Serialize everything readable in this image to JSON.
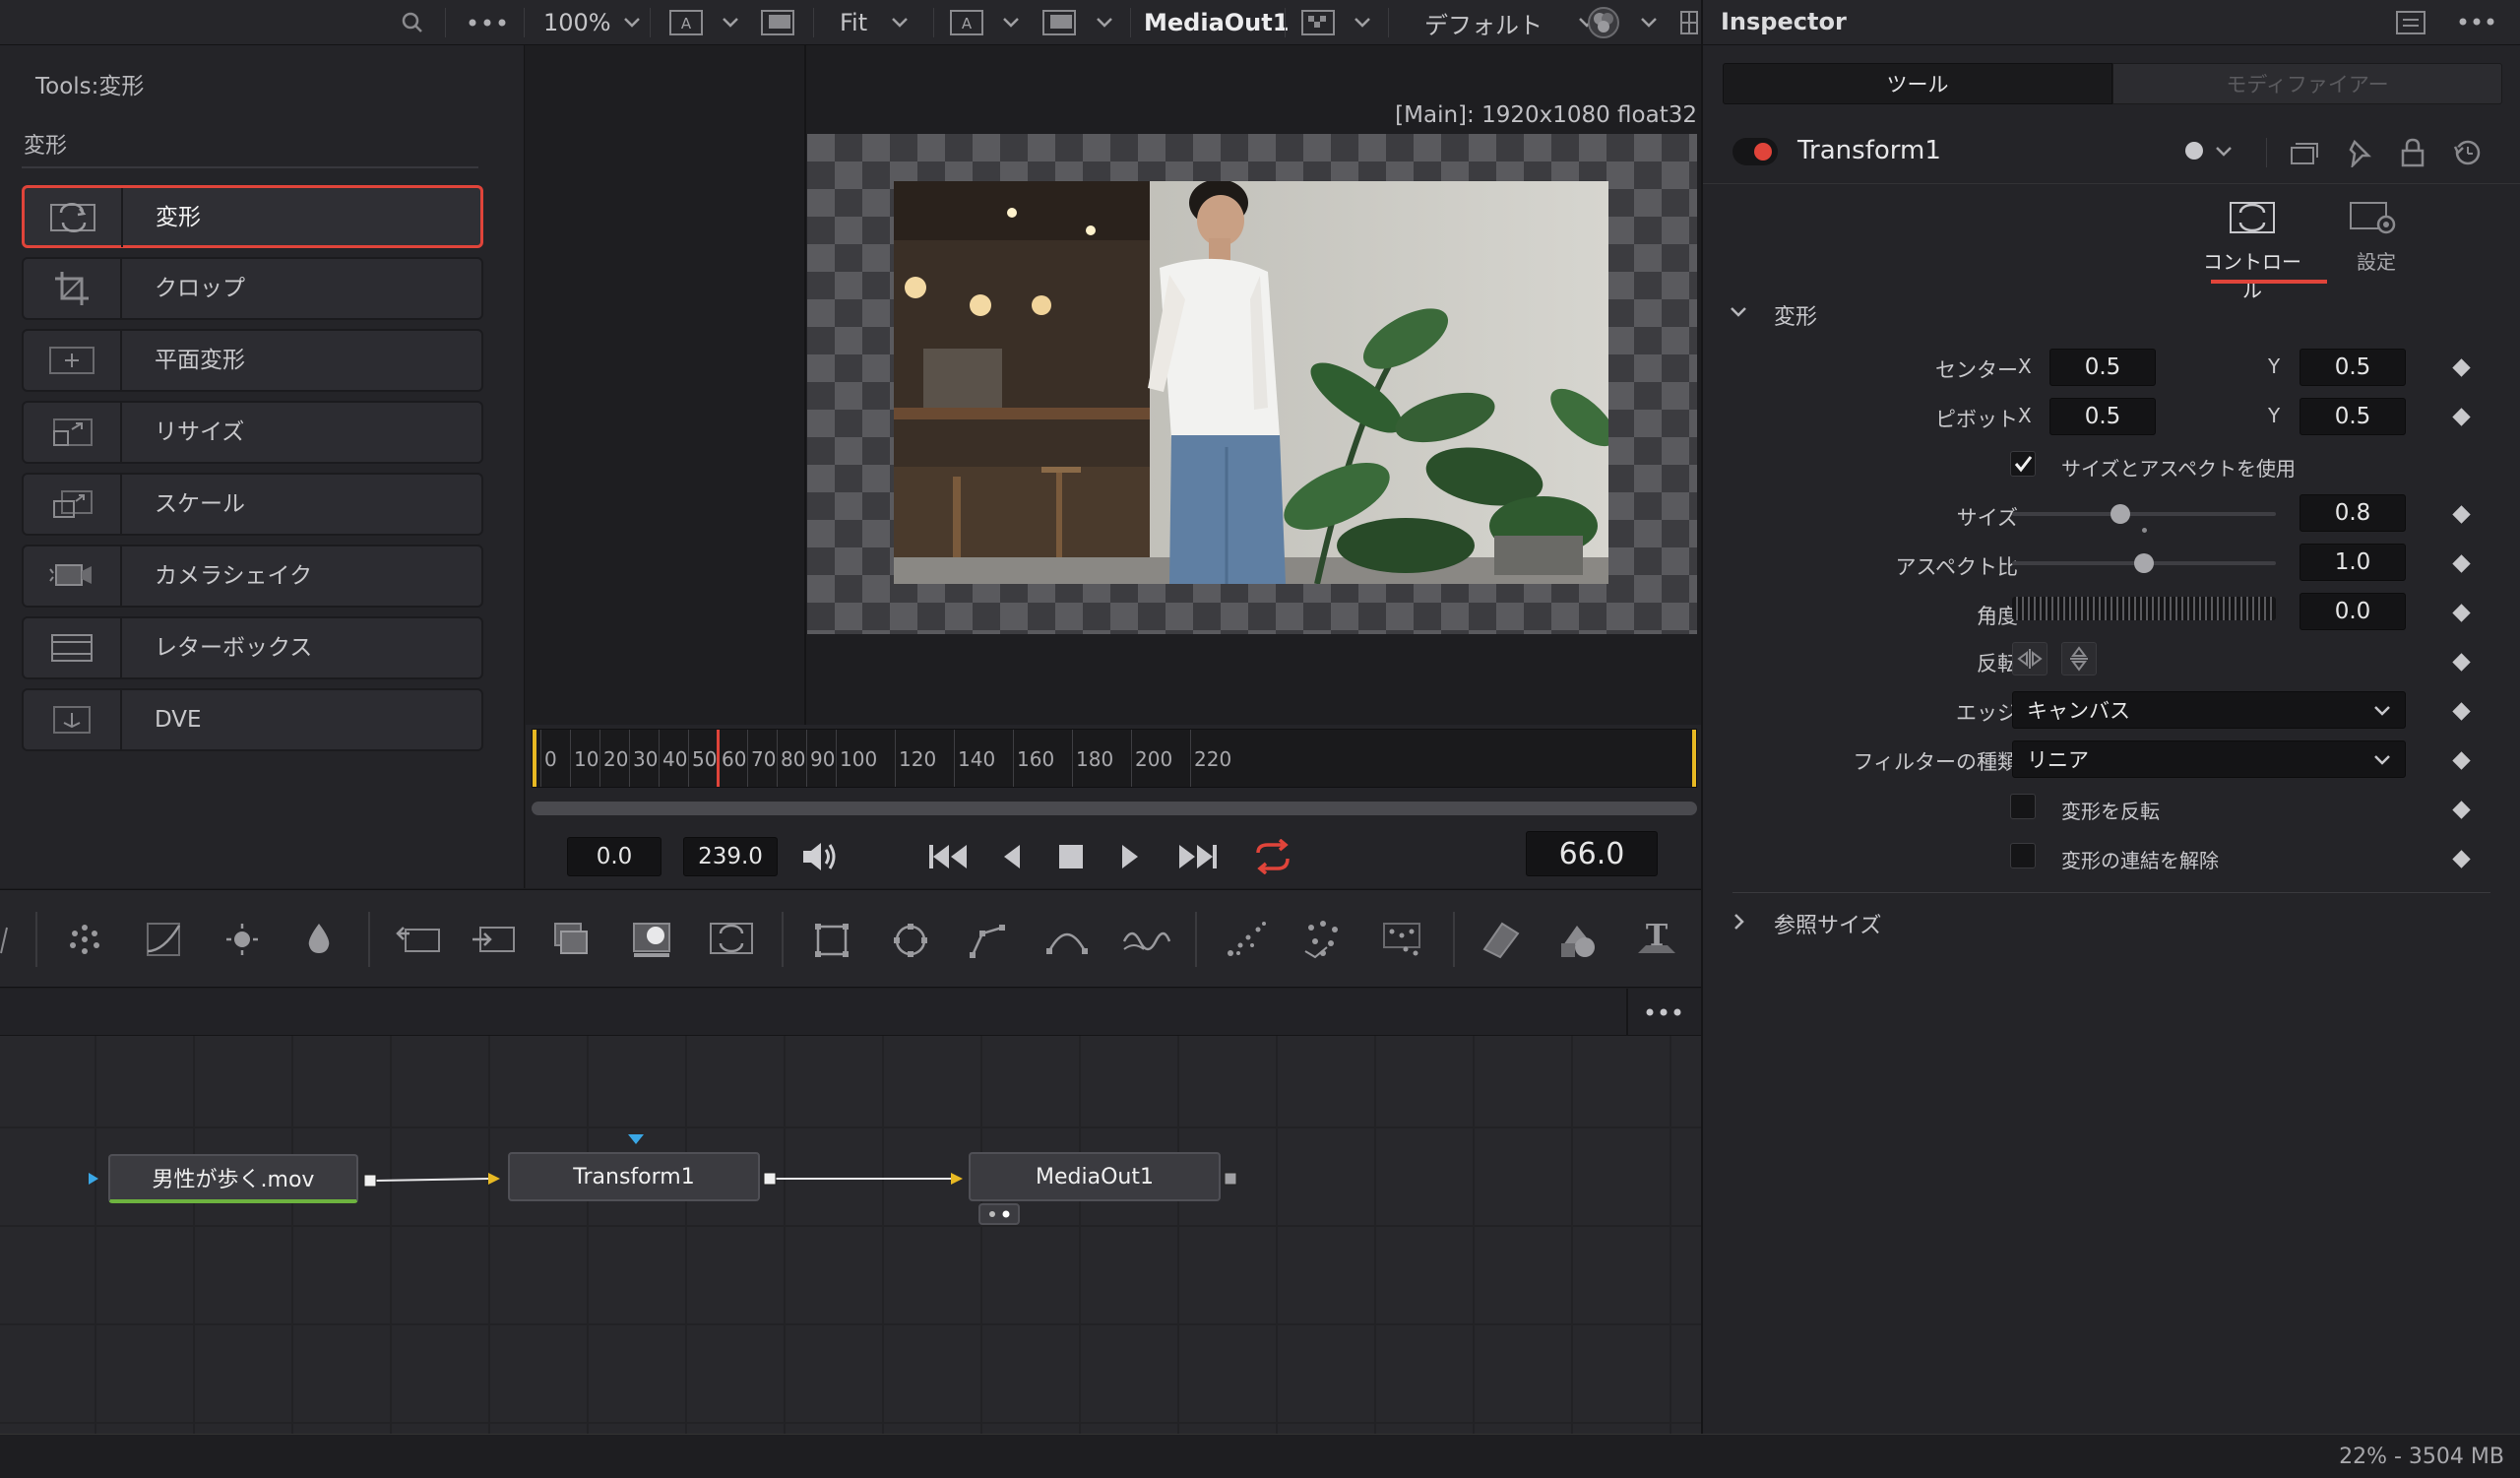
{
  "top_bar": {
    "zoom": "100%",
    "fit": "Fit",
    "viewer_name": "MediaOut1",
    "lut": "デフォルト"
  },
  "tools_panel": {
    "title": "Tools:変形",
    "section": "変形",
    "items": [
      {
        "label": "変形",
        "icon": "transform-icon",
        "selected": true
      },
      {
        "label": "クロップ",
        "icon": "crop-icon",
        "selected": false
      },
      {
        "label": "平面変形",
        "icon": "planar-transform-icon",
        "selected": false
      },
      {
        "label": "リサイズ",
        "icon": "resize-icon",
        "selected": false
      },
      {
        "label": "スケール",
        "icon": "scale-icon",
        "selected": false
      },
      {
        "label": "カメラシェイク",
        "icon": "camera-shake-icon",
        "selected": false
      },
      {
        "label": "レターボックス",
        "icon": "letterbox-icon",
        "selected": false
      },
      {
        "label": "DVE",
        "icon": "dve-icon",
        "selected": false
      }
    ]
  },
  "viewer": {
    "info": "[Main]: 1920x1080 float32"
  },
  "timeline": {
    "ticks": [
      "0",
      "10",
      "20",
      "30",
      "40",
      "50",
      "60",
      "70",
      "80",
      "90",
      "100",
      "120",
      "140",
      "160",
      "180",
      "200",
      "220"
    ],
    "start": "0.0",
    "end": "239.0",
    "current_frame": "66.0",
    "playhead_frame": 60
  },
  "node_graph": {
    "nodes": [
      {
        "label": "男性が歩く.mov"
      },
      {
        "label": "Transform1"
      },
      {
        "label": "MediaOut1"
      }
    ]
  },
  "inspector": {
    "title": "Inspector",
    "tabs": [
      "ツール",
      "モディファイアー"
    ],
    "node_name": "Transform1",
    "subtabs": [
      "コントロール",
      "設定"
    ],
    "section": "変形",
    "center": {
      "label": "センター",
      "x_label": "X",
      "x": "0.5",
      "y_label": "Y",
      "y": "0.5"
    },
    "pivot": {
      "label": "ピボット",
      "x_label": "X",
      "x": "0.5",
      "y_label": "Y",
      "y": "0.5"
    },
    "use_size_aspect": {
      "label": "サイズとアスペクトを使用",
      "checked": true
    },
    "size": {
      "label": "サイズ",
      "value": "0.8",
      "fraction": 0.41
    },
    "aspect": {
      "label": "アスペクト比",
      "value": "1.0",
      "fraction": 0.5
    },
    "angle": {
      "label": "角度",
      "value": "0.0"
    },
    "flip": {
      "label": "反転"
    },
    "edges": {
      "label": "エッジ",
      "value": "キャンバス"
    },
    "filter": {
      "label": "フィルターの種類",
      "value": "リニア"
    },
    "invert": {
      "label": "変形を反転",
      "checked": false
    },
    "unlink": {
      "label": "変形の連結を解除",
      "checked": false
    },
    "ref_size": "参照サイズ"
  },
  "status": {
    "memory": "22% - 3504 MB"
  },
  "colors": {
    "accent_red": "#e0443a",
    "playhead": "#e0443a",
    "yellow_marker": "#e8b923"
  }
}
